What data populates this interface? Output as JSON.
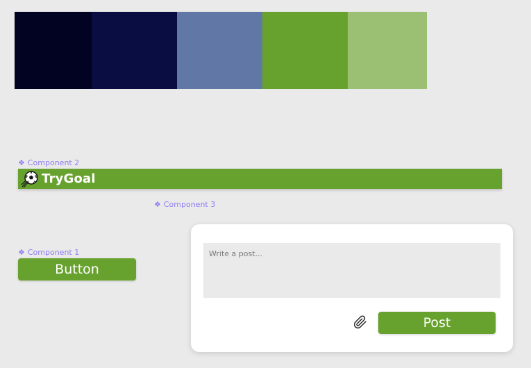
{
  "palette": {
    "colors": [
      "#020322",
      "#0a0d42",
      "#6177a6",
      "#68a22e",
      "#9cc073"
    ]
  },
  "theme": {
    "accent": "#68a22e",
    "component_label_color": "#8e7cf0"
  },
  "component_labels": {
    "glyph": "❖",
    "component_1": "Component 1",
    "component_2": "Component 2",
    "component_3": "Component 3"
  },
  "header": {
    "logo_icon": "soccer-ball-icon",
    "brand": "TryGoal"
  },
  "button_component": {
    "label": "Button"
  },
  "post_card": {
    "placeholder": "Write a post...",
    "attach_icon": "paperclip-icon",
    "post_label": "Post"
  }
}
